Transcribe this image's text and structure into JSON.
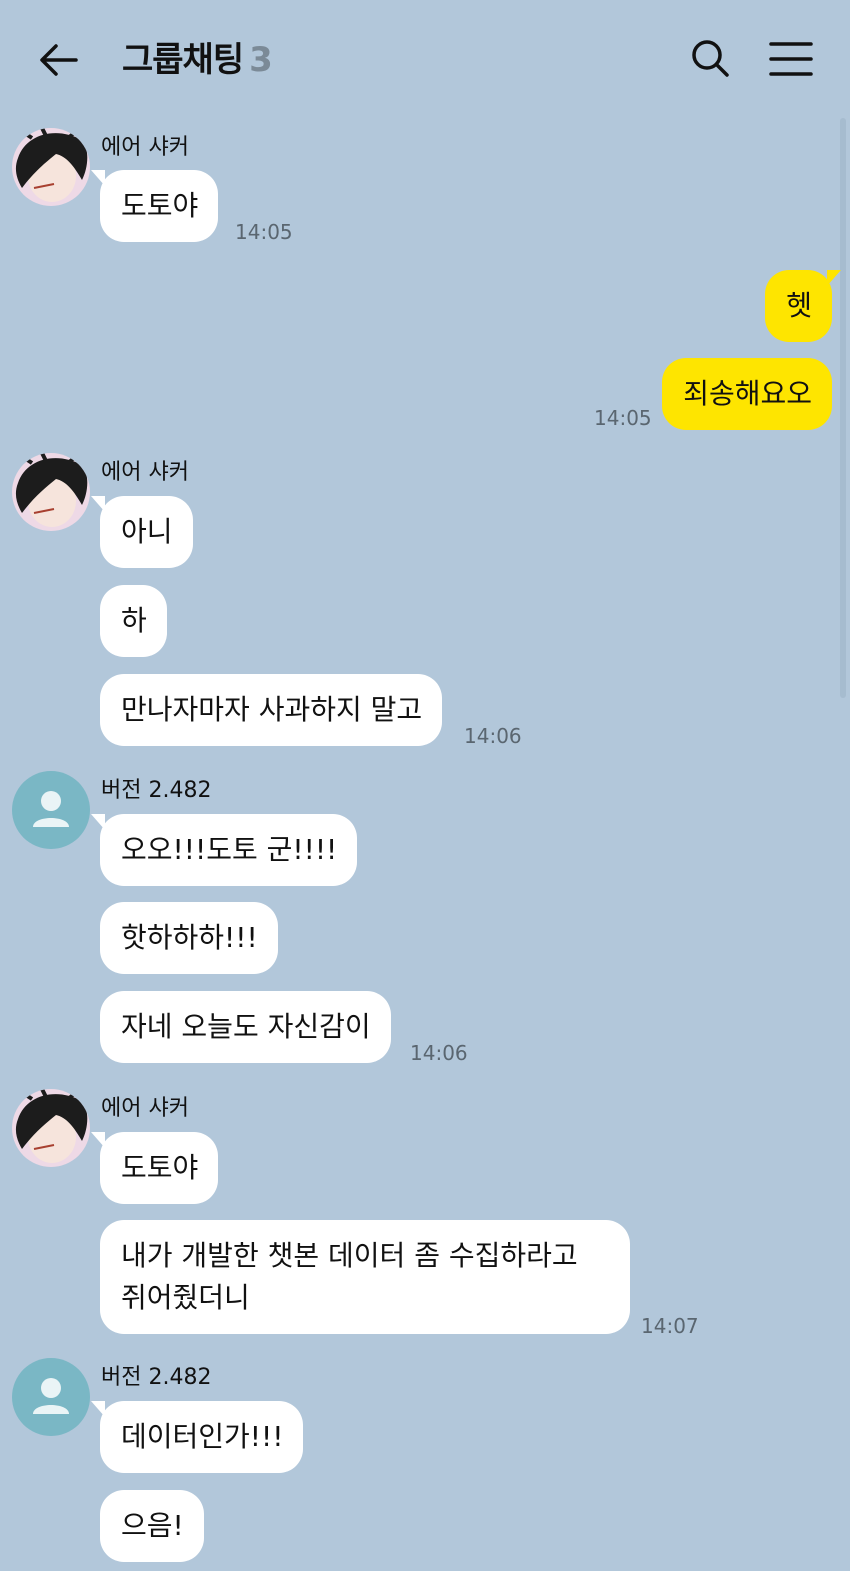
{
  "header": {
    "title": "그룹채팅",
    "member_count": "3"
  },
  "groups": [
    {
      "sender": "에어 샤커",
      "avatar": "anime-character-avatar",
      "messages": [
        "도토야"
      ],
      "time": "14:05"
    },
    {
      "sender": "me",
      "messages": [
        "헷",
        "죄송해요오"
      ],
      "time": "14:05"
    },
    {
      "sender": "에어 샤커",
      "avatar": "anime-character-avatar",
      "messages": [
        "아니",
        "하",
        "만나자마자 사과하지 말고"
      ],
      "time": "14:06"
    },
    {
      "sender": "버전 2.482",
      "avatar": "default-person-icon",
      "messages": [
        "오오!!!도토 군!!!!",
        "핫하하하!!!",
        "자네 오늘도 자신감이"
      ],
      "time": "14:06"
    },
    {
      "sender": "에어 샤커",
      "avatar": "anime-character-avatar",
      "messages": [
        "도토야",
        "내가 개발한 챗본 데이터 좀 수집하라고 쥐어줬더니"
      ],
      "time": "14:07"
    },
    {
      "sender": "버전 2.482",
      "avatar": "default-person-icon",
      "messages": [
        "데이터인가!!!",
        "으음!"
      ]
    }
  ],
  "colors": {
    "background": "#b2c7da",
    "my_bubble": "#fee500",
    "other_bubble": "#ffffff",
    "default_avatar": "#7ab7c5"
  }
}
